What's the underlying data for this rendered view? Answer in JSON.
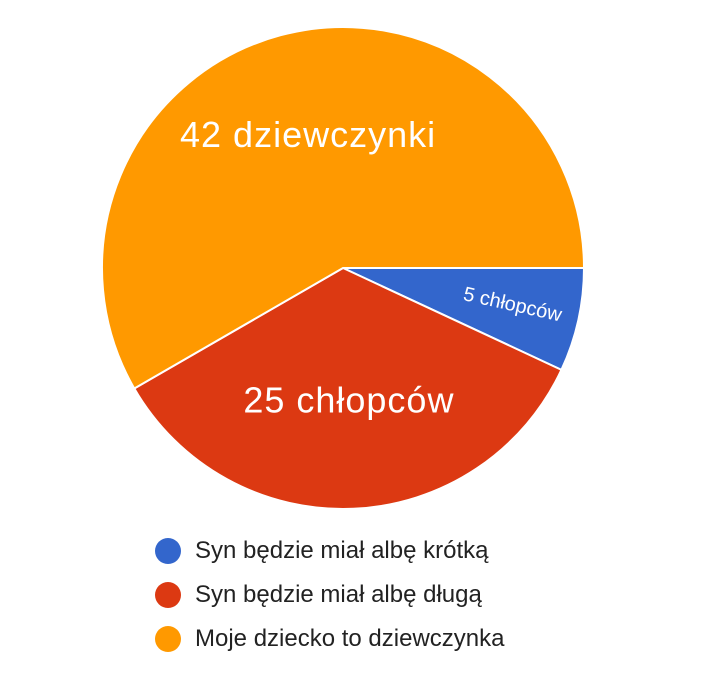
{
  "chart_data": {
    "type": "pie",
    "title": "",
    "slices": [
      {
        "label": "Syn będzie miał albę krótką",
        "value": 5,
        "data_label": "5 chłopców",
        "color": "#3366cc"
      },
      {
        "label": "Syn będzie miał albę długą",
        "value": 25,
        "data_label": "25 chłopców",
        "color": "#dc3912"
      },
      {
        "label": "Moje dziecko to dziewczynka",
        "value": 42,
        "data_label": "42 dziewczynki",
        "color": "#ff9900"
      }
    ],
    "start_angle_deg": 0,
    "direction": "clockwise",
    "legend_position": "bottom"
  }
}
